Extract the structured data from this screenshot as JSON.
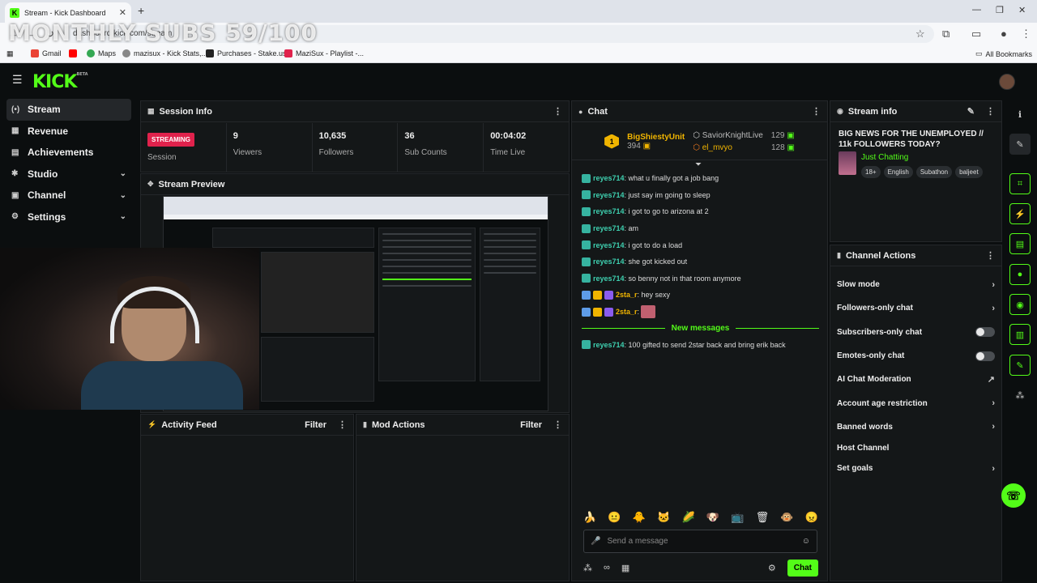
{
  "browser": {
    "tab_title": "Stream - Kick Dashboard",
    "url": "dashboard.kick.com/stream",
    "overlay_text": "MONTHLY SUBS 59/100",
    "bookmarks": [
      "Gmail",
      "",
      "Maps",
      "mazisux - Kick Stats,...",
      "Purchases - Stake.us",
      "MaziSux - Playlist -..."
    ],
    "all_bookmarks": "All Bookmarks"
  },
  "app": {
    "logo": "KICK",
    "logo_beta": "BETA"
  },
  "sidebar": {
    "items": [
      {
        "label": "Stream",
        "icon": "(•)",
        "active": true,
        "has_chevron": false
      },
      {
        "label": "Revenue",
        "icon": "▦",
        "has_chevron": false
      },
      {
        "label": "Achievements",
        "icon": "▤",
        "has_chevron": false
      },
      {
        "label": "Studio",
        "icon": "✱",
        "has_chevron": true
      },
      {
        "label": "Channel",
        "icon": "▣",
        "has_chevron": true
      },
      {
        "label": "Settings",
        "icon": "⚙",
        "has_chevron": true
      }
    ]
  },
  "session": {
    "title": "Session Info",
    "status_badge": "STREAMING",
    "status_label": "Session",
    "viewers_value": "9",
    "viewers_label": "Viewers",
    "followers_value": "10,635",
    "followers_label": "Followers",
    "subs_value": "36",
    "subs_label": "Sub Counts",
    "time_value": "00:04:02",
    "time_label": "Time Live"
  },
  "preview": {
    "title": "Stream Preview"
  },
  "activity": {
    "title": "Activity Feed",
    "filter": "Filter"
  },
  "modactions": {
    "title": "Mod Actions",
    "filter": "Filter"
  },
  "chat": {
    "title": "Chat",
    "top_gifter": {
      "rank": "1",
      "name": "BigShiestyUnit",
      "count": "394"
    },
    "gifters": [
      {
        "name": "SaviorKnightLive",
        "count": "129"
      },
      {
        "name": "el_mvyo",
        "count": "128"
      }
    ],
    "messages": [
      {
        "user": "reyes714",
        "text": ": what u finally got a job bang"
      },
      {
        "user": "reyes714",
        "text": ": just say im going to sleep"
      },
      {
        "user": "reyes714",
        "text": ": i got to go to arizona at 2"
      },
      {
        "user": "reyes714",
        "text": ": am"
      },
      {
        "user": "reyes714",
        "text": ": i got to do a load"
      },
      {
        "user": "reyes714",
        "text": ": she got kicked out"
      },
      {
        "user": "reyes714",
        "text": ": so benny not in that room anymore"
      },
      {
        "user": "2sta_r",
        "text": ": hey sexy"
      },
      {
        "user": "2sta_r",
        "text": ":"
      }
    ],
    "new_messages": "New messages",
    "after_messages": [
      {
        "user": "reyes714",
        "text": ": 100 gifted to send 2star back and bring erik back"
      }
    ],
    "placeholder": "Send a message",
    "send_label": "Chat"
  },
  "streaminfo": {
    "title": "Stream info",
    "stream_title": "BIG NEWS FOR THE UNEMPLOYED // 11k FOLLOWERS TODAY?",
    "category": "Just Chatting",
    "tags": [
      "18+",
      "English",
      "Subathon",
      "baljeet"
    ]
  },
  "channelactions": {
    "title": "Channel Actions",
    "items": [
      {
        "label": "Slow mode",
        "control": "chevron"
      },
      {
        "label": "Followers-only chat",
        "control": "chevron"
      },
      {
        "label": "Subscribers-only chat",
        "control": "toggle"
      },
      {
        "label": "Emotes-only chat",
        "control": "toggle"
      },
      {
        "label": "AI Chat Moderation",
        "control": "external"
      },
      {
        "label": "Account age restriction",
        "control": "chevron"
      },
      {
        "label": "Banned words",
        "control": "chevron"
      },
      {
        "label": "Host Channel",
        "control": "none"
      },
      {
        "label": "Set goals",
        "control": "chevron"
      }
    ]
  },
  "colors": {
    "accent": "#53fc18",
    "live": "#e0224c",
    "gold": "#f0b400",
    "username": "#3ed0b0"
  }
}
